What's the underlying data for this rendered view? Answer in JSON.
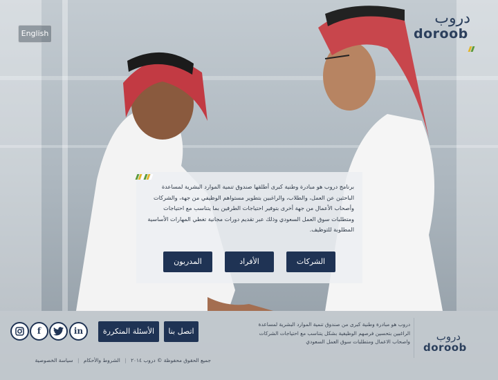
{
  "header": {
    "language_button": "English",
    "logo_ar": "دروب",
    "logo_en": "doroob"
  },
  "card": {
    "description": "برنامج دروب هو مبادرة وطنية كبرى أطلقها صندوق تنمية الموارد البشرية لمساعدة الباحثين عن العمل، والطلاب، والراغبين بتطوير مستواهم الوظيفي من جهة، والشركات وأصحاب الأعمال من جهة أخرى بتوفير احتياجات الطرفين بما يتناسب مع احتياجات ومتطلبات سوق العمل السعودي وذلك عبر تقديم دورات مجانية تغطي المهارات الأساسية المطلوبة للتوظيف.",
    "buttons": {
      "companies": "الشركات",
      "individuals": "الأفراد",
      "trainers": "المدربون"
    }
  },
  "footer": {
    "logo_ar": "دروب",
    "logo_en": "doroob",
    "description": "دروب هو مبادرة وطنية كبرى من صندوق تنمية الموارد البشرية لمساعدة الراغبين بتحسين فرصهم الوظيفية بشكل يتناسب مع احتياجات الشركات واصحاب الاعمال ومتطلبات سوق العمل السعودي",
    "contact_button": "اتصل بنا",
    "faq_button": "الأسئلة المتكررة",
    "copyright": "جميع الحقوق محفوظة © دروب ٢٠١٤",
    "terms": "الشروط والأحكام",
    "privacy": "سياسة الخصوصية",
    "separator": "|",
    "social": [
      "linkedin-icon",
      "twitter-icon",
      "facebook-icon",
      "instagram-icon"
    ]
  },
  "colors": {
    "brand_navy": "#1f3354",
    "stripe_green": "#5a9a3a",
    "stripe_yellow": "#e3b52a",
    "stripe_white": "#ffffff"
  }
}
